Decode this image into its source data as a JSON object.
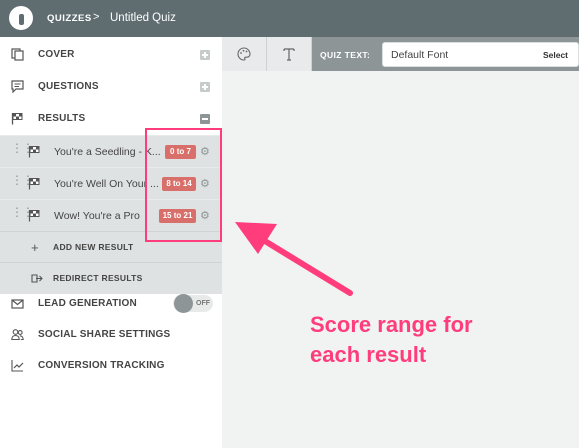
{
  "topbar": {
    "section": "QUIZZES",
    "separator": ">",
    "quiz_title": "Untitled Quiz"
  },
  "sidebar": {
    "cover": "COVER",
    "questions": "QUESTIONS",
    "results": "RESULTS",
    "result_items": [
      {
        "name": "You're a Seedling - K...",
        "range": "0 to 7"
      },
      {
        "name": "You're Well On Your ...",
        "range": "8 to 14"
      },
      {
        "name": "Wow! You're a Pro",
        "range": "15 to 21"
      }
    ],
    "add_new_result": "ADD NEW RESULT",
    "redirect_results": "REDIRECT RESULTS",
    "lead_generation": "LEAD GENERATION",
    "lead_toggle": "OFF",
    "social_share": "SOCIAL SHARE SETTINGS",
    "conversion_tracking": "CONVERSION TRACKING"
  },
  "toolbar": {
    "quiz_text_label": "QUIZ TEXT:",
    "font_value": "Default Font",
    "select_label": "Select"
  },
  "annotation": {
    "line1": "Score range for",
    "line2": "each result"
  },
  "colors": {
    "accent": "#ff3d7c",
    "badge": "#d96f6a",
    "topbar": "#5f6d71"
  }
}
